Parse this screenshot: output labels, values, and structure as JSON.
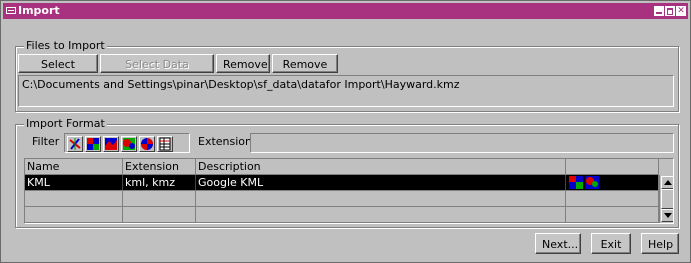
{
  "window": {
    "title": "Import",
    "accent": "#a8327f"
  },
  "files_group": {
    "legend": "Files to Import",
    "buttons": {
      "select_files": "Select Files...",
      "select_data_source": "Select Data Source...",
      "remove": "Remove",
      "remove_all": "Remove All"
    },
    "selected_path": "C:\\Documents and Settings\\pinar\\Desktop\\sf_data\\datafor Import\\Hayward.kmz"
  },
  "format_group": {
    "legend": "Import Format",
    "filter_label": "Filter",
    "filter_icons": [
      "vector-filter-icon",
      "raster-filter-icon",
      "surface-filter-icon",
      "elevation-filter-icon",
      "multi-filter-icon",
      "table-filter-icon"
    ],
    "extension_label": "Extension",
    "extension_value": "",
    "table": {
      "columns": [
        "Name",
        "Extension",
        "Description",
        ""
      ],
      "rows": [
        {
          "name": "KML",
          "extension": "kml, kmz",
          "description": "Google KML",
          "type_icons": [
            "raster-type-icon",
            "surface-type-icon"
          ],
          "selected": true
        },
        {
          "name": "",
          "extension": "",
          "description": "",
          "type_icons": [],
          "selected": false
        },
        {
          "name": "",
          "extension": "",
          "description": "",
          "type_icons": [],
          "selected": false
        }
      ]
    }
  },
  "footer": {
    "next": "Next...",
    "exit": "Exit",
    "help": "Help"
  }
}
